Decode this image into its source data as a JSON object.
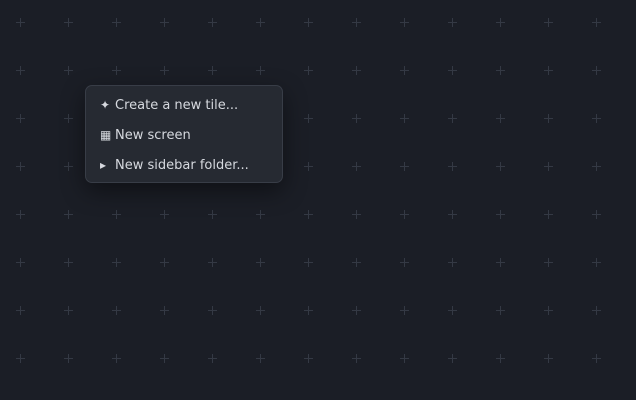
{
  "context_menu": {
    "items": [
      {
        "icon": "sparkle-icon",
        "glyph": "✦",
        "label": "Create a new tile..."
      },
      {
        "icon": "grid-icon",
        "glyph": "▦",
        "label": "New screen"
      },
      {
        "icon": "triangle-right-icon",
        "glyph": "▸",
        "label": "New sidebar folder..."
      }
    ]
  },
  "colors": {
    "background": "#1b1e26",
    "grid_mark": "#343944",
    "menu_background": "#262a32",
    "menu_border": "#383d47",
    "menu_text": "#d6d9df"
  }
}
